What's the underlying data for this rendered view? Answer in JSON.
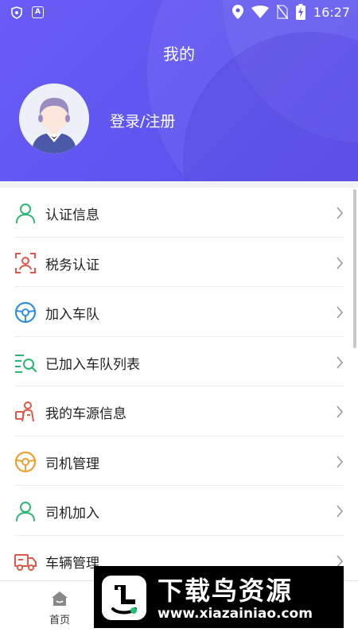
{
  "status_bar": {
    "left_icons": [
      "shield-icon",
      "a-badge-icon"
    ],
    "a_badge": "A",
    "right_icons": [
      "location-icon",
      "wifi-icon",
      "no-sim-icon",
      "battery-charging-icon"
    ],
    "time": "16:27"
  },
  "header": {
    "title": "我的",
    "login_text": "登录/注册",
    "avatar_icon": "default-avatar-icon"
  },
  "menu": [
    {
      "label": "认证信息",
      "icon": "person-icon",
      "color": "#2bb673"
    },
    {
      "label": "税务认证",
      "icon": "face-scan-icon",
      "color": "#e0574b"
    },
    {
      "label": "加入车队",
      "icon": "steering-wheel-icon",
      "color": "#2f8fdb"
    },
    {
      "label": "已加入车队列表",
      "icon": "list-search-icon",
      "color": "#2bb673"
    },
    {
      "label": "我的车源信息",
      "icon": "courier-icon",
      "color": "#e0574b"
    },
    {
      "label": "司机管理",
      "icon": "steering-wheel-icon",
      "color": "#f0a030"
    },
    {
      "label": "司机加入",
      "icon": "person-icon",
      "color": "#2bb673"
    },
    {
      "label": "车辆管理",
      "icon": "truck-icon",
      "color": "#e0574b"
    }
  ],
  "bottom_nav": {
    "home_label": "首页",
    "home_icon": "home-icon"
  },
  "watermark": {
    "text": "下载鸟资源",
    "url": "www.xiazainiao.com",
    "logo_icon": "bird-logo-icon"
  },
  "colors": {
    "header_purple": "#5e55f0",
    "green": "#2bb673",
    "red": "#e0574b",
    "blue": "#2f8fdb",
    "orange": "#f0a030"
  }
}
